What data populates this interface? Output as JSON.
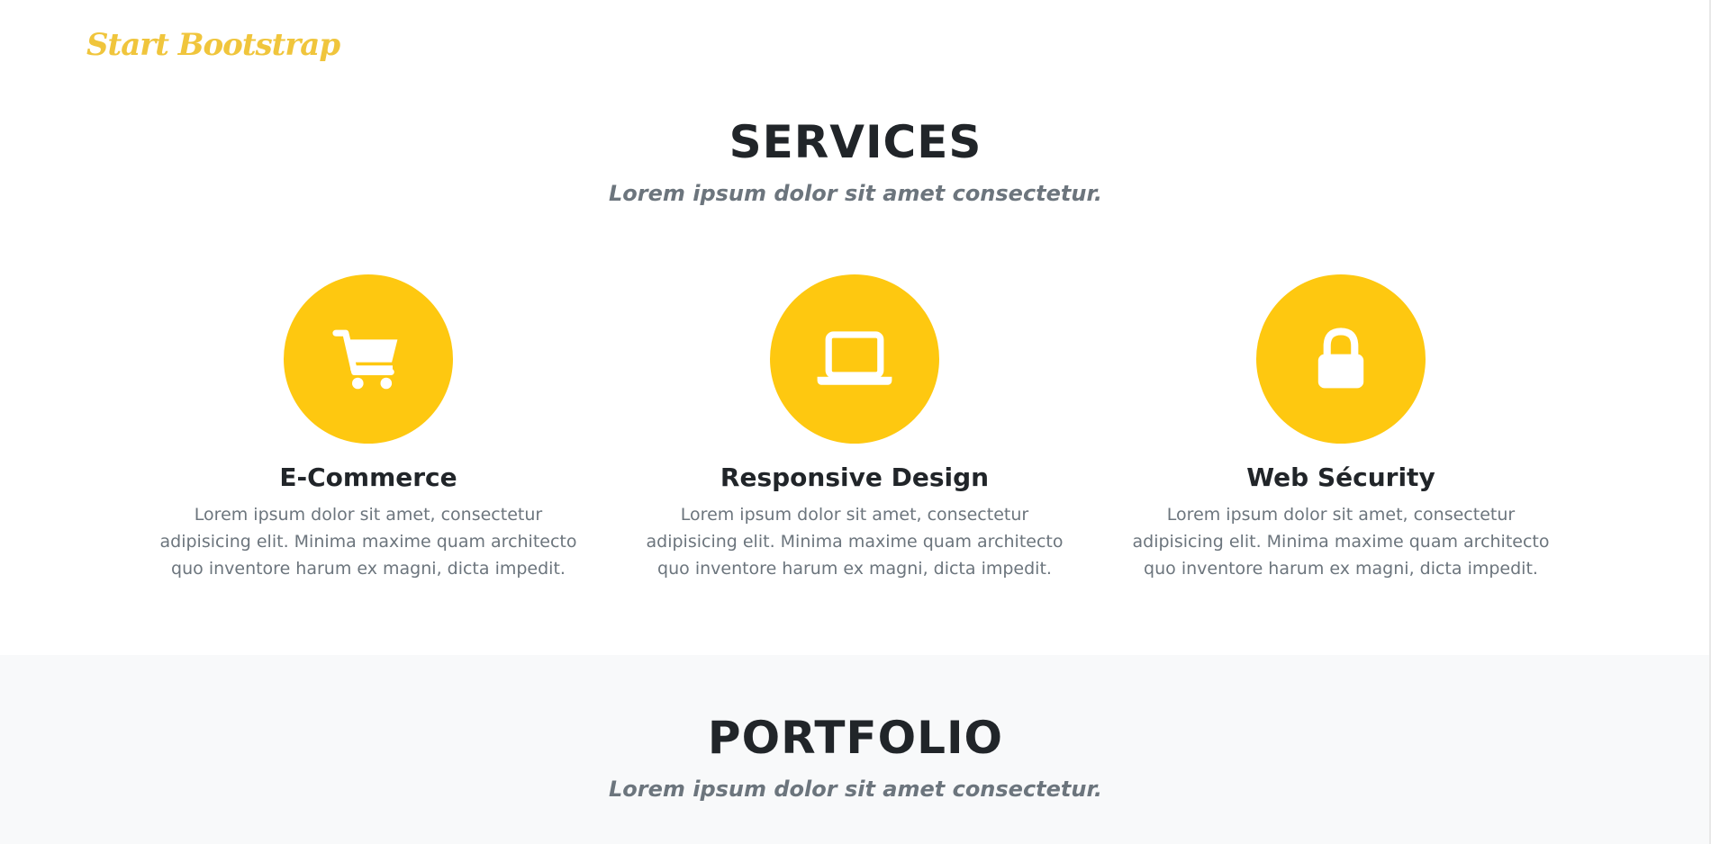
{
  "navbar": {
    "brand": "Start Bootstrap"
  },
  "services": {
    "heading": "SERVICES",
    "subheading": "Lorem ipsum dolor sit amet consectetur.",
    "items": [
      {
        "icon": "shopping-cart-icon",
        "title": "E-Commerce",
        "text": "Lorem ipsum dolor sit amet, consectetur adipisicing elit. Minima maxime quam architecto quo inventore harum ex magni, dicta impedit."
      },
      {
        "icon": "laptop-icon",
        "title": "Responsive Design",
        "text": "Lorem ipsum dolor sit amet, consectetur adipisicing elit. Minima maxime quam architecto quo inventore harum ex magni, dicta impedit."
      },
      {
        "icon": "lock-icon",
        "title": "Web Sécurity",
        "text": "Lorem ipsum dolor sit amet, consectetur adipisicing elit. Minima maxime quam architecto quo inventore harum ex magni, dicta impedit."
      }
    ]
  },
  "portfolio": {
    "heading": "PORTFOLIO",
    "subheading": "Lorem ipsum dolor sit amet consectetur."
  },
  "colors": {
    "accent": "#fec810",
    "brand": "#f0c53c",
    "heading": "#212529",
    "muted": "#6c757d",
    "portfolio_bg": "#f8f9fa"
  }
}
